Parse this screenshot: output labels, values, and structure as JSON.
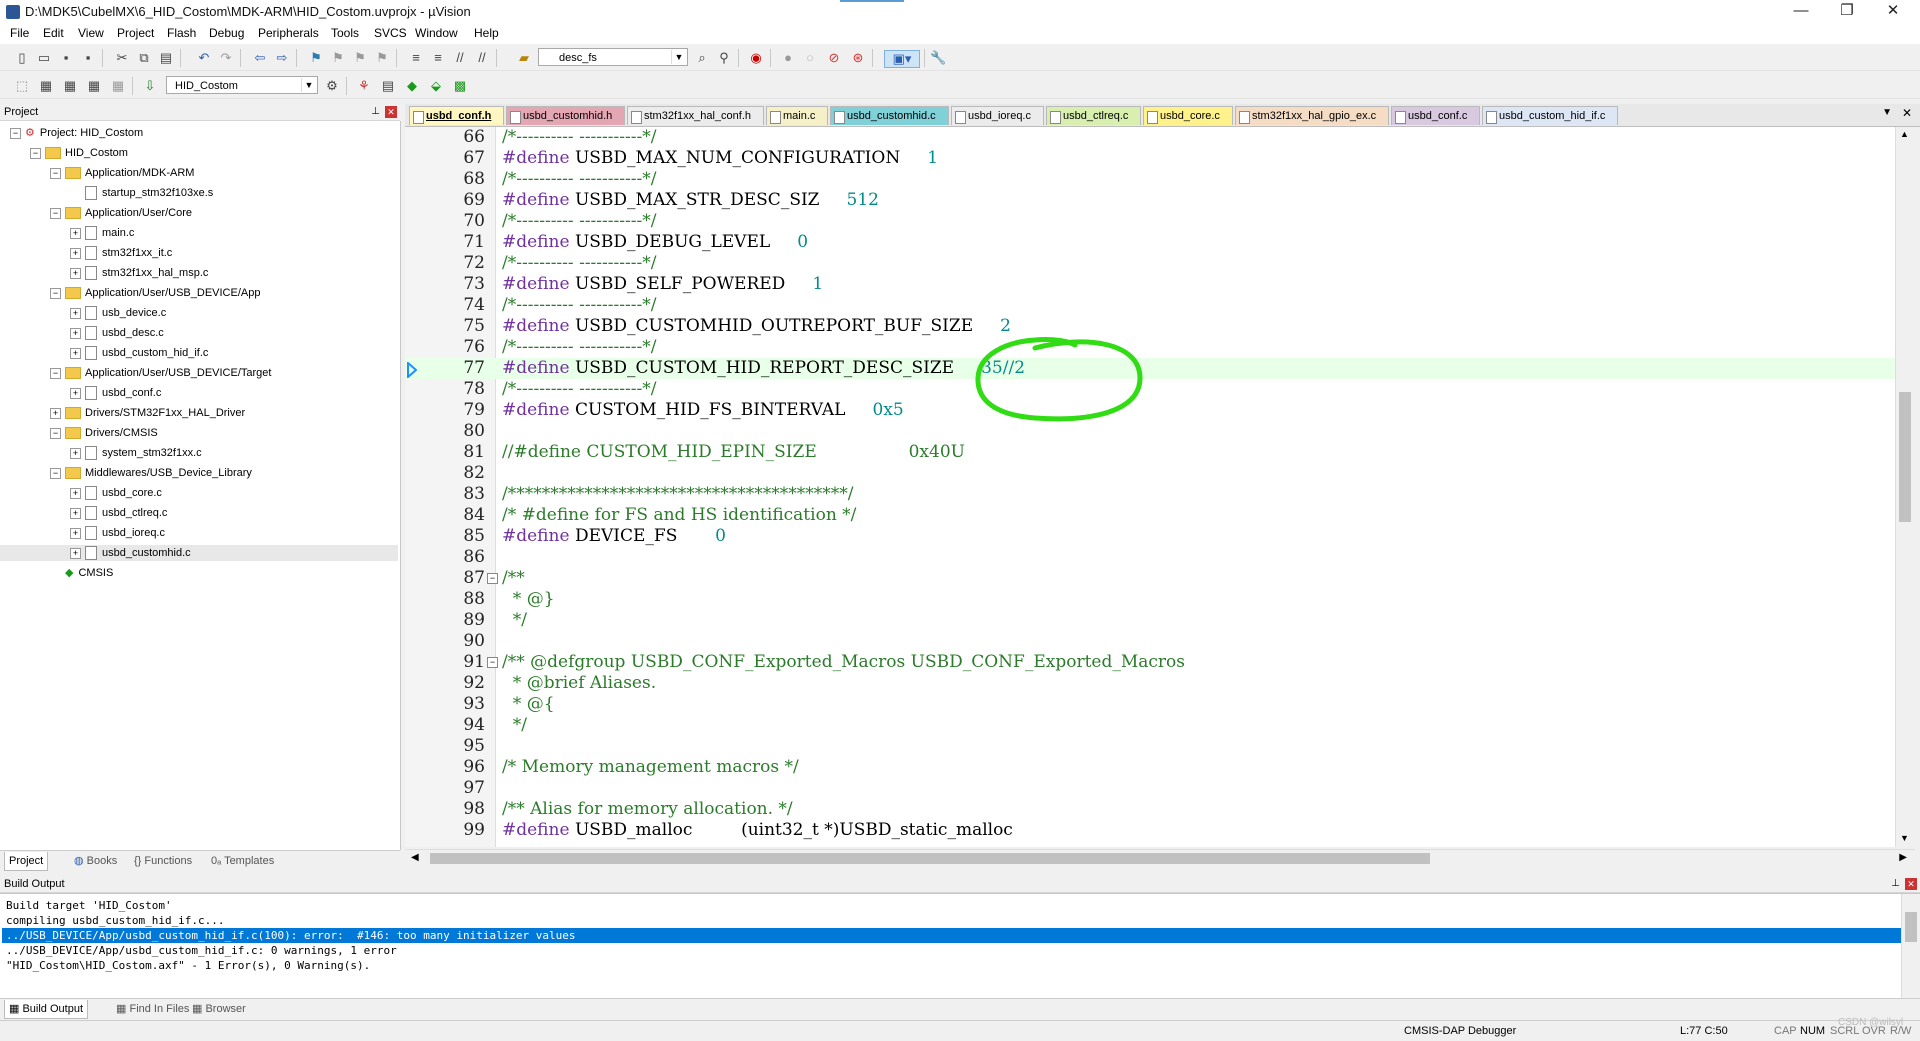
{
  "window": {
    "title": "D:\\MDK5\\CubelMX\\6_HID_Costom\\MDK-ARM\\HID_Costom.uvprojx - µVision",
    "minimize": "—",
    "maximize": "❐",
    "close": "✕"
  },
  "menu": [
    "File",
    "Edit",
    "View",
    "Project",
    "Flash",
    "Debug",
    "Peripherals",
    "Tools",
    "SVCS",
    "Window",
    "Help"
  ],
  "toolbar": {
    "find_combo_value": "desc_fs",
    "target_combo_value": "HID_Costom"
  },
  "project_panel": {
    "title": "Project",
    "tree": [
      {
        "label": "Project: HID_Costom",
        "level": 0,
        "type": "root",
        "exp": "−"
      },
      {
        "label": "HID_Costom",
        "level": 1,
        "type": "folder",
        "exp": "−"
      },
      {
        "label": "Application/MDK-ARM",
        "level": 2,
        "type": "folder",
        "exp": "−"
      },
      {
        "label": "startup_stm32f103xe.s",
        "level": 3,
        "type": "file",
        "exp": ""
      },
      {
        "label": "Application/User/Core",
        "level": 2,
        "type": "folder",
        "exp": "−"
      },
      {
        "label": "main.c",
        "level": 3,
        "type": "file",
        "exp": "+"
      },
      {
        "label": "stm32f1xx_it.c",
        "level": 3,
        "type": "file",
        "exp": "+"
      },
      {
        "label": "stm32f1xx_hal_msp.c",
        "level": 3,
        "type": "file",
        "exp": "+"
      },
      {
        "label": "Application/User/USB_DEVICE/App",
        "level": 2,
        "type": "folder",
        "exp": "−"
      },
      {
        "label": "usb_device.c",
        "level": 3,
        "type": "file",
        "exp": "+"
      },
      {
        "label": "usbd_desc.c",
        "level": 3,
        "type": "file",
        "exp": "+"
      },
      {
        "label": "usbd_custom_hid_if.c",
        "level": 3,
        "type": "file",
        "exp": "+"
      },
      {
        "label": "Application/User/USB_DEVICE/Target",
        "level": 2,
        "type": "folder",
        "exp": "−"
      },
      {
        "label": "usbd_conf.c",
        "level": 3,
        "type": "file",
        "exp": "+"
      },
      {
        "label": "Drivers/STM32F1xx_HAL_Driver",
        "level": 2,
        "type": "folder",
        "exp": "+"
      },
      {
        "label": "Drivers/CMSIS",
        "level": 2,
        "type": "folder",
        "exp": "−"
      },
      {
        "label": "system_stm32f1xx.c",
        "level": 3,
        "type": "file",
        "exp": "+"
      },
      {
        "label": "Middlewares/USB_Device_Library",
        "level": 2,
        "type": "folder",
        "exp": "−"
      },
      {
        "label": "usbd_core.c",
        "level": 3,
        "type": "file",
        "exp": "+"
      },
      {
        "label": "usbd_ctlreq.c",
        "level": 3,
        "type": "file",
        "exp": "+"
      },
      {
        "label": "usbd_ioreq.c",
        "level": 3,
        "type": "file",
        "exp": "+"
      },
      {
        "label": "usbd_customhid.c",
        "level": 3,
        "type": "file",
        "exp": "+",
        "selected": true
      },
      {
        "label": "CMSIS",
        "level": 2,
        "type": "gem",
        "exp": ""
      }
    ],
    "tabs": [
      "Project",
      "Books",
      "{} Functions",
      "0ₐ Templates"
    ]
  },
  "editor": {
    "tabs": [
      {
        "label": "usbd_conf.h",
        "color": "#fff6c2",
        "active": true
      },
      {
        "label": "usbd_customhid.h",
        "color": "#e5a6b4"
      },
      {
        "label": "stm32f1xx_hal_conf.h",
        "color": "#ececec"
      },
      {
        "label": "main.c",
        "color": "#f5f0c8"
      },
      {
        "label": "usbd_customhid.c",
        "color": "#7fd0d7"
      },
      {
        "label": "usbd_ioreq.c",
        "color": "#ececec"
      },
      {
        "label": "usbd_ctlreq.c",
        "color": "#d8efb0"
      },
      {
        "label": "usbd_core.c",
        "color": "#fff28a"
      },
      {
        "label": "stm32f1xx_hal_gpio_ex.c",
        "color": "#f5dcc4"
      },
      {
        "label": "usbd_conf.c",
        "color": "#d8c8e0"
      },
      {
        "label": "usbd_custom_hid_if.c",
        "color": "#dde6f5"
      }
    ],
    "current_line": "77",
    "lines": [
      {
        "n": "66",
        "fold": "",
        "p": [
          [
            "c-cm",
            "/*---------- -----------*/"
          ]
        ]
      },
      {
        "n": "67",
        "fold": "",
        "p": [
          [
            "c-pp",
            "#define "
          ],
          [
            "c-id",
            "USBD_MAX_NUM_CONFIGURATION     "
          ],
          [
            "c-num",
            "1"
          ]
        ]
      },
      {
        "n": "68",
        "fold": "",
        "p": [
          [
            "c-cm",
            "/*---------- -----------*/"
          ]
        ]
      },
      {
        "n": "69",
        "fold": "",
        "p": [
          [
            "c-pp",
            "#define "
          ],
          [
            "c-id",
            "USBD_MAX_STR_DESC_SIZ     "
          ],
          [
            "c-num",
            "512"
          ]
        ]
      },
      {
        "n": "70",
        "fold": "",
        "p": [
          [
            "c-cm",
            "/*---------- -----------*/"
          ]
        ]
      },
      {
        "n": "71",
        "fold": "",
        "p": [
          [
            "c-pp",
            "#define "
          ],
          [
            "c-id",
            "USBD_DEBUG_LEVEL     "
          ],
          [
            "c-num",
            "0"
          ]
        ]
      },
      {
        "n": "72",
        "fold": "",
        "p": [
          [
            "c-cm",
            "/*---------- -----------*/"
          ]
        ]
      },
      {
        "n": "73",
        "fold": "",
        "p": [
          [
            "c-pp",
            "#define "
          ],
          [
            "c-id",
            "USBD_SELF_POWERED     "
          ],
          [
            "c-num",
            "1"
          ]
        ]
      },
      {
        "n": "74",
        "fold": "",
        "p": [
          [
            "c-cm",
            "/*---------- -----------*/"
          ]
        ]
      },
      {
        "n": "75",
        "fold": "",
        "p": [
          [
            "c-pp",
            "#define "
          ],
          [
            "c-id",
            "USBD_CUSTOMHID_OUTREPORT_BUF_SIZE     "
          ],
          [
            "c-num",
            "2"
          ]
        ]
      },
      {
        "n": "76",
        "fold": "",
        "p": [
          [
            "c-cm",
            "/*---------- -----------*/"
          ]
        ]
      },
      {
        "n": "77",
        "fold": "",
        "p": [
          [
            "c-pp",
            "#define "
          ],
          [
            "c-id",
            "USBD_CUSTOM_HID_REPORT_DESC_SIZE     "
          ],
          [
            "c-num",
            "35//2"
          ]
        ]
      },
      {
        "n": "78",
        "fold": "",
        "p": [
          [
            "c-cm",
            "/*---------- -----------*/"
          ]
        ]
      },
      {
        "n": "79",
        "fold": "",
        "p": [
          [
            "c-pp",
            "#define "
          ],
          [
            "c-id",
            "CUSTOM_HID_FS_BINTERVAL     "
          ],
          [
            "c-num",
            "0x5"
          ]
        ]
      },
      {
        "n": "80",
        "fold": "",
        "p": []
      },
      {
        "n": "81",
        "fold": "",
        "p": [
          [
            "c-cm",
            "//#define CUSTOM_HID_EPIN_SIZE                 0x40U"
          ]
        ]
      },
      {
        "n": "82",
        "fold": "",
        "p": []
      },
      {
        "n": "83",
        "fold": "",
        "p": [
          [
            "c-cm",
            "/****************************************/"
          ]
        ]
      },
      {
        "n": "84",
        "fold": "",
        "p": [
          [
            "c-cm",
            "/* #define for FS and HS identification */"
          ]
        ]
      },
      {
        "n": "85",
        "fold": "",
        "p": [
          [
            "c-pp",
            "#define "
          ],
          [
            "c-id",
            "DEVICE_FS       "
          ],
          [
            "c-num",
            "0"
          ]
        ]
      },
      {
        "n": "86",
        "fold": "",
        "p": []
      },
      {
        "n": "87",
        "fold": "−",
        "p": [
          [
            "c-cm",
            "/**"
          ]
        ]
      },
      {
        "n": "88",
        "fold": "",
        "p": [
          [
            "c-cm",
            "  * @}"
          ]
        ]
      },
      {
        "n": "89",
        "fold": "",
        "p": [
          [
            "c-cm",
            "  */"
          ]
        ]
      },
      {
        "n": "90",
        "fold": "",
        "p": []
      },
      {
        "n": "91",
        "fold": "−",
        "p": [
          [
            "c-cm",
            "/** @defgroup USBD_CONF_Exported_Macros USBD_CONF_Exported_Macros"
          ]
        ]
      },
      {
        "n": "92",
        "fold": "",
        "p": [
          [
            "c-cm",
            "  * @brief Aliases."
          ]
        ]
      },
      {
        "n": "93",
        "fold": "",
        "p": [
          [
            "c-cm",
            "  * @{"
          ]
        ]
      },
      {
        "n": "94",
        "fold": "",
        "p": [
          [
            "c-cm",
            "  */"
          ]
        ]
      },
      {
        "n": "95",
        "fold": "",
        "p": []
      },
      {
        "n": "96",
        "fold": "",
        "p": [
          [
            "c-cm",
            "/* Memory management macros */"
          ]
        ]
      },
      {
        "n": "97",
        "fold": "",
        "p": []
      },
      {
        "n": "98",
        "fold": "",
        "p": [
          [
            "c-cm",
            "/** Alias for memory allocation. */"
          ]
        ]
      },
      {
        "n": "99",
        "fold": "",
        "p": [
          [
            "c-pp",
            "#define "
          ],
          [
            "c-id",
            "USBD_malloc         (uint32_t *)USBD_static_malloc"
          ]
        ]
      }
    ]
  },
  "build_output": {
    "title": "Build Output",
    "lines": [
      "Build target 'HID_Costom'",
      "compiling usbd_custom_hid_if.c...",
      "../USB_DEVICE/App/usbd_custom_hid_if.c(100): error:  #146: too many initializer values",
      "../USB_DEVICE/App/usbd_custom_hid_if.c: 0 warnings, 1 error",
      "\"HID_Costom\\HID_Costom.axf\" - 1 Error(s), 0 Warning(s)."
    ],
    "error_index": 2,
    "tabs": [
      "Build Output",
      "Find In Files",
      "Browser"
    ]
  },
  "status": {
    "debugger": "CMSIS-DAP Debugger",
    "position": "L:77 C:50",
    "cap": "CAP",
    "num": "NUM",
    "scrl": "SCRL",
    "ovr": "OVR",
    "rw": "R/W",
    "watermark": "CSDN @wilsyl"
  },
  "colors": {
    "annotation": "#32dc14",
    "selection": "#0078d7",
    "current_line": "#e8ffe8"
  }
}
